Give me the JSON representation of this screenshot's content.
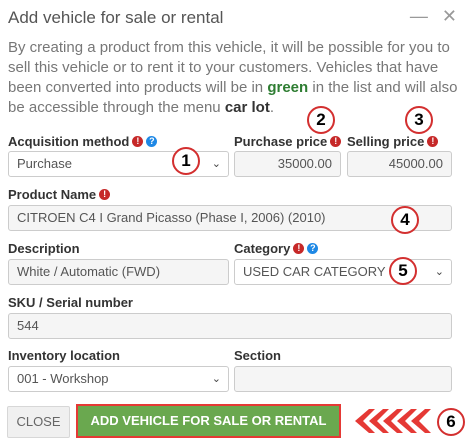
{
  "dialog": {
    "title": "Add vehicle for sale or rental",
    "minimize_glyph": "—",
    "close_glyph": "✕",
    "intro": {
      "part1": "By creating a product from this vehicle, it will be possible for you to sell this vehicle or to rent it to your customers. Vehicles that have been converted into products will be in ",
      "green_word": "green",
      "part2": " in the list and will also be accessible through the menu ",
      "menu_name": "car lot",
      "part3": "."
    }
  },
  "form": {
    "acquisition_method": {
      "label": "Acquisition method",
      "value": "Purchase"
    },
    "purchase_price": {
      "label": "Purchase price",
      "value": "35000.00"
    },
    "selling_price": {
      "label": "Selling price",
      "value": "45000.00"
    },
    "product_name": {
      "label": "Product Name",
      "value": "CITROEN C4 I Grand Picasso (Phase I, 2006) (2010)"
    },
    "description": {
      "label": "Description",
      "value": "White / Automatic (FWD)"
    },
    "category": {
      "label": "Category",
      "value": "USED CAR CATEGORY"
    },
    "sku": {
      "label": "SKU / Serial number",
      "value": "544"
    },
    "inventory_location": {
      "label": "Inventory location",
      "value": "001 - Workshop"
    },
    "section": {
      "label": "Section",
      "value": ""
    }
  },
  "icons": {
    "required": "!",
    "help": "?",
    "chevron": "⌄"
  },
  "markers": [
    "1",
    "2",
    "3",
    "4",
    "5",
    "6"
  ],
  "buttons": {
    "close": "CLOSE",
    "submit": "ADD VEHICLE FOR SALE OR RENTAL"
  },
  "colors": {
    "submit_bg": "#6aa84f",
    "highlight_red": "#e53935",
    "required_icon": "#c62828",
    "help_icon": "#1e88e5",
    "green_text": "#2e7d32"
  }
}
